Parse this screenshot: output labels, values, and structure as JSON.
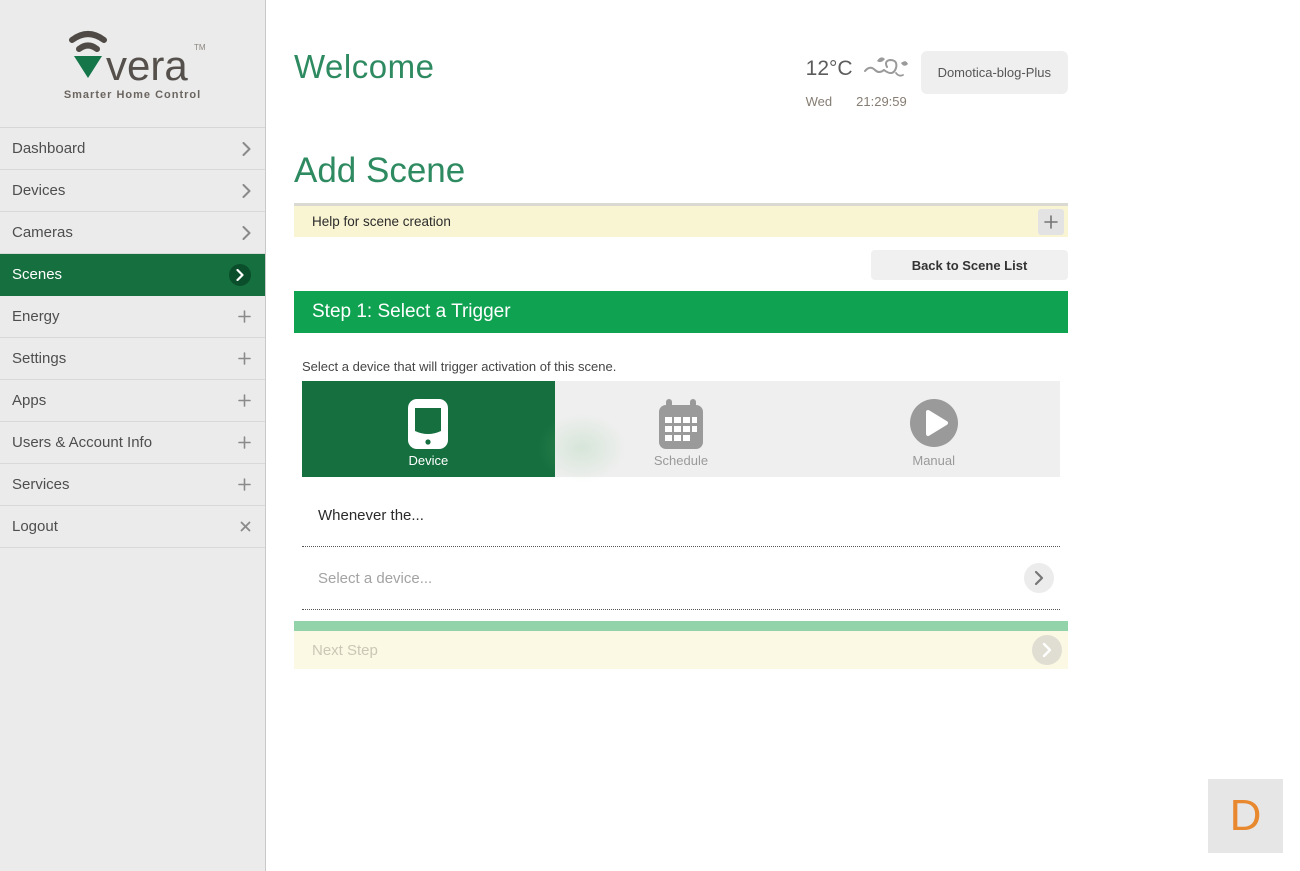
{
  "brand": {
    "name": "vera",
    "tm": "TM",
    "tagline": "Smarter Home Control"
  },
  "sidebar": {
    "items": [
      {
        "label": "Dashboard",
        "icon": "chevron-right-icon",
        "selected": false
      },
      {
        "label": "Devices",
        "icon": "chevron-right-icon",
        "selected": false
      },
      {
        "label": "Cameras",
        "icon": "chevron-right-icon",
        "selected": false
      },
      {
        "label": "Scenes",
        "icon": "chevron-right-icon",
        "selected": true
      },
      {
        "label": "Energy",
        "icon": "plus-icon",
        "selected": false
      },
      {
        "label": "Settings",
        "icon": "plus-icon",
        "selected": false
      },
      {
        "label": "Apps",
        "icon": "plus-icon",
        "selected": false
      },
      {
        "label": "Users & Account Info",
        "icon": "plus-icon",
        "selected": false
      },
      {
        "label": "Services",
        "icon": "plus-icon",
        "selected": false
      },
      {
        "label": "Logout",
        "icon": "close-icon",
        "selected": false
      }
    ]
  },
  "header": {
    "title": "Welcome",
    "temperature": "12°C",
    "weather_icon": "windy-swirl-icon",
    "day": "Wed",
    "time": "21:29:59",
    "controller_name": "Domotica-blog-Plus"
  },
  "scene": {
    "page_title": "Add Scene",
    "help_label": "Help for scene creation",
    "help_expand_icon": "plus-icon",
    "back_button": "Back to Scene List",
    "step_title": "Step 1: Select a Trigger",
    "instruction": "Select a device that will trigger activation of this scene.",
    "triggers": [
      {
        "label": "Device",
        "icon": "device-tablet-icon",
        "selected": true
      },
      {
        "label": "Schedule",
        "icon": "calendar-icon",
        "selected": false
      },
      {
        "label": "Manual",
        "icon": "play-circle-icon",
        "selected": false
      }
    ],
    "whenever_label": "Whenever the...",
    "select_device_label": "Select a device...",
    "next_step_label": "Next Step"
  },
  "avatar": {
    "initial": "D"
  },
  "colors": {
    "sidebar_bg": "#ebebeb",
    "selected_green": "#156f3e",
    "badge_green": "#0b4e2b",
    "step_bar_green": "#0fa251",
    "title_green": "#2e8a60",
    "help_yellow": "#f9f5d3",
    "next_step_yellow": "#fbf8e3",
    "progress_light_green": "#93d3aa",
    "avatar_orange": "#e8882f"
  }
}
